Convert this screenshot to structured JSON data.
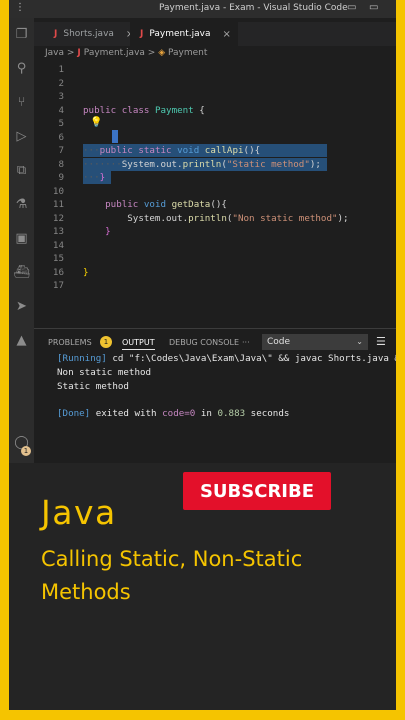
{
  "window": {
    "title": "Payment.java - Exam - Visual Studio Code"
  },
  "tabs": [
    {
      "label": "Shorts.java",
      "icon": "java-file-icon"
    },
    {
      "label": "Payment.java",
      "icon": "java-file-icon"
    }
  ],
  "breadcrumb": {
    "root": "Java",
    "sep": ">",
    "file": "Payment.java",
    "symbol": "Payment"
  },
  "editor": {
    "line_numbers": [
      "1",
      "2",
      "3",
      "4",
      "5",
      "6",
      "7",
      "8",
      "9",
      "10",
      "11",
      "12",
      "13",
      "14",
      "15",
      "16",
      "17"
    ],
    "code": {
      "class_kw1": "public",
      "class_kw2": "class",
      "class_name": "Payment",
      "class_brace": "{",
      "m1_kw1": "public",
      "m1_kw2": "static",
      "m1_kw3": "void",
      "m1_name": "callApi",
      "m1_rest": "(){",
      "m1_body_obj": "System.out.",
      "m1_body_fn": "println",
      "m1_body_str": "\"Static method\"",
      "m1_body_end": ");",
      "m1_close": "}",
      "m2_kw1": "public",
      "m2_kw2": "void",
      "m2_name": "getData",
      "m2_rest": "(){",
      "m2_body_obj": "System.out.",
      "m2_body_fn": "println",
      "m2_body_str": "\"Non static method\"",
      "m2_body_end": ");",
      "m2_close": "}",
      "class_close": "}"
    }
  },
  "panel": {
    "tabs": {
      "problems": "PROBLEMS",
      "problems_count": "1",
      "output": "OUTPUT",
      "debug": "DEBUG CONSOLE",
      "more": "···"
    },
    "channel_select": "Code",
    "output": {
      "running_tag": "[Running]",
      "running_cmd": " cd \"f:\\Codes\\Java\\Exam\\Java\\\" && javac Shorts.java &&",
      "line1": "Non static method",
      "line2": "Static method",
      "done_tag": "[Done]",
      "done_text1": " exited with ",
      "done_code": "code=0",
      "done_text2": " in ",
      "done_time": "0.883",
      "done_text3": " seconds"
    }
  },
  "activity_badge": "1",
  "banner": {
    "title": "Java",
    "subtitle": "Calling Static, Non-Static Methods",
    "subscribe": "SUBSCRIBE"
  },
  "colors": {
    "background": "#f5c400",
    "banner_text": "#f5c400",
    "subscribe": "#e3102a",
    "editor_bg": "#1e1e1e"
  }
}
